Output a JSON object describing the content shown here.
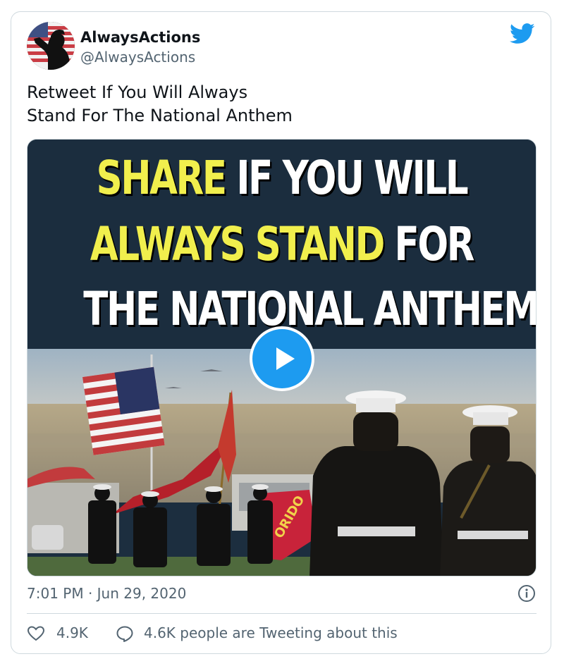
{
  "author": {
    "name": "AlwaysActions",
    "handle": "@AlwaysActions"
  },
  "tweet": {
    "text_line1": "Retweet If You Will Always",
    "text_line2": "Stand For The National Anthem",
    "timestamp": "7:01 PM · Jun 29, 2020"
  },
  "media": {
    "headline_line1_highlight": "SHARE",
    "headline_line1_rest": " IF YOU WILL",
    "headline_line2_highlight": "ALWAYS STAND",
    "headline_line2_rest": " FOR",
    "headline_line3": "THE NATIONAL ANTHEM!",
    "flag_text": "ORIDO",
    "highlight_color": "#f1ef4d"
  },
  "engagement": {
    "likes": "4.9K",
    "conversation": "4.6K people are Tweeting about this"
  },
  "icons": {
    "brand": "twitter-bird-icon",
    "play": "play-icon",
    "info": "info-icon",
    "like": "heart-icon",
    "reply": "speech-bubble-icon"
  },
  "colors": {
    "twitter_blue": "#1d9bf0",
    "secondary_text": "#536471"
  }
}
